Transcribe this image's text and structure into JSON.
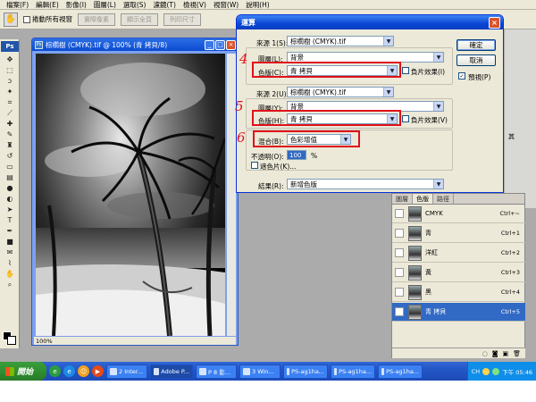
{
  "menubar": {
    "items": [
      "檔案(F)",
      "編輯(E)",
      "影像(I)",
      "圖層(L)",
      "選取(S)",
      "濾鏡(T)",
      "檢視(V)",
      "視窗(W)",
      "說明(H)"
    ]
  },
  "options": {
    "scroll_all_label": "捲動所有視窗",
    "btn_actual": "實際像素",
    "btn_fit": "顯示全頁",
    "btn_print": "列印尺寸"
  },
  "toolbox": {
    "logo": "Ps"
  },
  "document": {
    "title": "棕櫚樹 (CMYK).tif @ 100% (青 拷貝/8)",
    "zoom": "100%"
  },
  "dialog": {
    "title": "運算",
    "source1": {
      "label": "來源 1(S):",
      "file": "棕櫚樹 (CMYK).tif",
      "layer_label": "圖層(L):",
      "layer": "背景",
      "channel_label": "色版(C):",
      "channel": "青 拷貝",
      "invert_label": "負片效果(I)"
    },
    "source2": {
      "label": "來源 2(U):",
      "file": "棕櫚樹 (CMYK).tif",
      "layer_label": "圖層(Y):",
      "layer": "背景",
      "channel_label": "色版(H):",
      "channel": "青 拷貝",
      "invert_label": "負片效果(V)"
    },
    "blending": {
      "label": "混合(B):",
      "mode": "色彩增值",
      "opacity_label": "不透明(O):",
      "opacity": "100",
      "opacity_unit": "%",
      "mask_label": "遮色片(K)..."
    },
    "result": {
      "label": "結果(R):",
      "value": "新增色版"
    },
    "buttons": {
      "ok": "確定",
      "reset": "取消",
      "preview_label": "預視(P)"
    },
    "annotations": [
      "4",
      "5",
      "6"
    ]
  },
  "side": {
    "fx_label": "其"
  },
  "layers_panel": {
    "tabs": [
      "圖層",
      "色版",
      "路徑"
    ],
    "channels": [
      {
        "name": "CMYK",
        "key": "Ctrl+~"
      },
      {
        "name": "青",
        "key": "Ctrl+1"
      },
      {
        "name": "洋紅",
        "key": "Ctrl+2"
      },
      {
        "name": "黃",
        "key": "Ctrl+3"
      },
      {
        "name": "黑",
        "key": "Ctrl+4"
      },
      {
        "name": "青 拷貝",
        "key": "Ctrl+5"
      }
    ]
  },
  "taskbar": {
    "start": "開始",
    "tasks": [
      "2 Inter...",
      "Adobe P...",
      "P 8 影...",
      "3 Win...",
      "PS-ag1ha...",
      "PS-ag1ha...",
      "PS-ag1ha..."
    ],
    "lang": "CH",
    "clock": "下午 05:46"
  }
}
